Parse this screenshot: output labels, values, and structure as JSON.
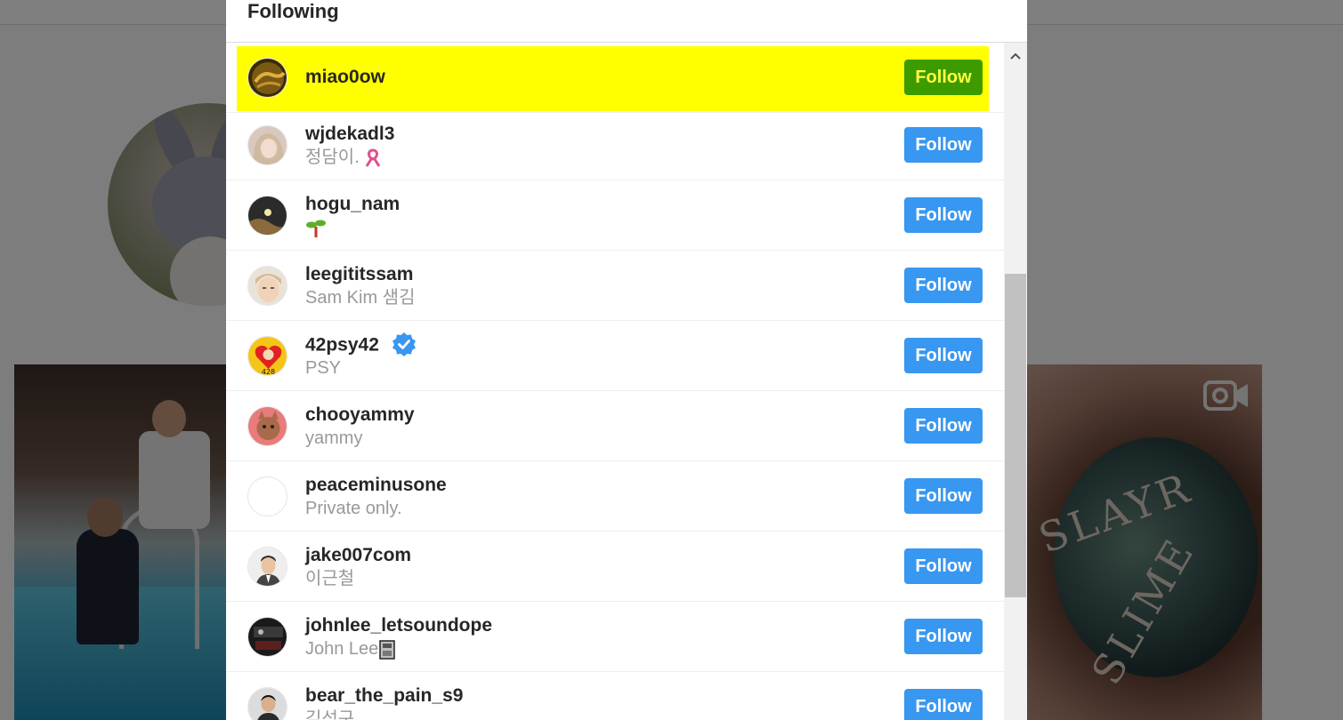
{
  "modal": {
    "title": "Following"
  },
  "following": [
    {
      "username": "miao0ow",
      "fullname": "",
      "button": "Follow",
      "highlighted": true,
      "avatar_icon": "avatar-icon"
    },
    {
      "username": "wjdekadl3",
      "fullname": "정담이.",
      "fullname_emoji": "ribbon-icon",
      "button": "Follow",
      "avatar_icon": "avatar-icon"
    },
    {
      "username": "hogu_nam",
      "fullname": "",
      "fullname_emoji": "sprout-icon",
      "button": "Follow",
      "avatar_icon": "avatar-icon"
    },
    {
      "username": "leegititssam",
      "fullname": "Sam Kim 샘김",
      "button": "Follow",
      "avatar_icon": "avatar-icon"
    },
    {
      "username": "42psy42",
      "fullname": "PSY",
      "verified": true,
      "button": "Follow",
      "avatar_icon": "avatar-icon"
    },
    {
      "username": "chooyammy",
      "fullname": "yammy",
      "button": "Follow",
      "avatar_icon": "avatar-icon"
    },
    {
      "username": "peaceminusone",
      "fullname": "Private only.",
      "button": "Follow",
      "avatar_icon": "avatar-icon"
    },
    {
      "username": "jake007com",
      "fullname": "이근철",
      "button": "Follow",
      "avatar_icon": "avatar-icon"
    },
    {
      "username": "johnlee_letsoundope",
      "fullname": "John Lee",
      "fullname_emoji": "box-icon",
      "button": "Follow",
      "avatar_icon": "avatar-icon"
    },
    {
      "username": "bear_the_pain_s9",
      "fullname": "김성구",
      "button": "Follow",
      "avatar_icon": "avatar-icon"
    }
  ],
  "background": {
    "photo_right_text_1": "SLAYR",
    "photo_right_text_2": "SLIME",
    "photo_right_icon": "video-camera-icon"
  },
  "colors": {
    "follow_button": "#3897f0",
    "highlight": "#ffff00",
    "highlighted_button": "#3d9b00"
  }
}
